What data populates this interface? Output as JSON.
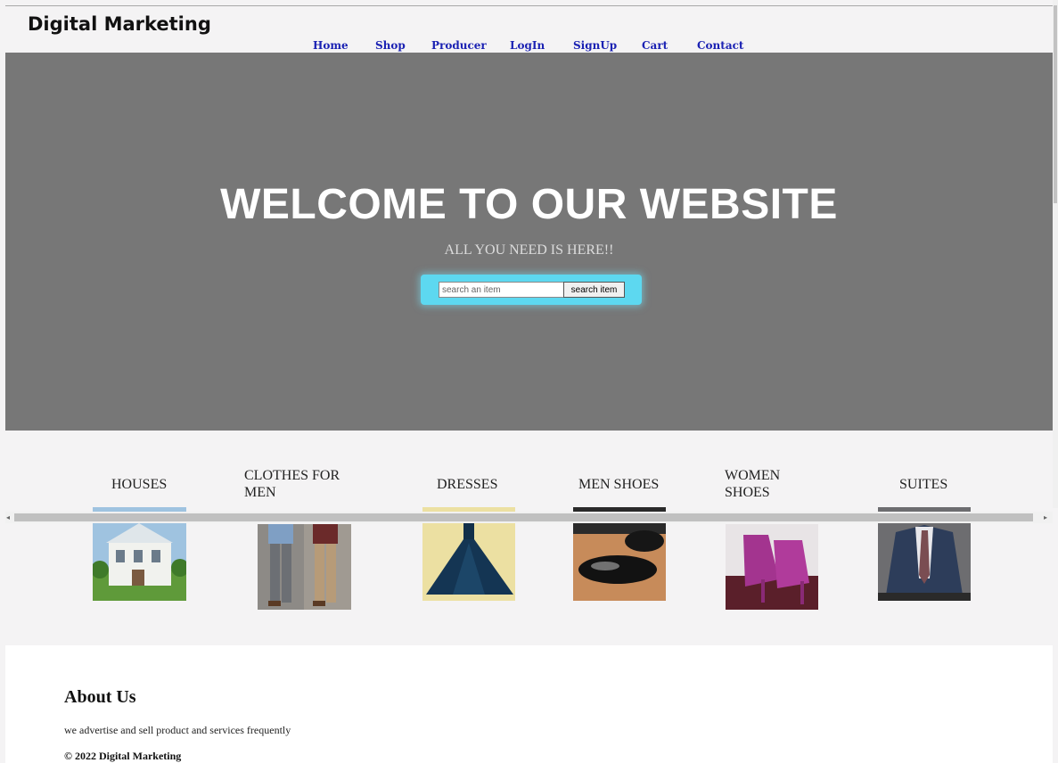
{
  "brand": "Digital Marketing",
  "nav": [
    "Home",
    "Shop",
    "Producer",
    "LogIn",
    "SignUp",
    "Cart",
    "Contact"
  ],
  "hero": {
    "title": "WELCOME TO OUR WEBSITE",
    "subtitle": "ALL YOU NEED IS HERE!!",
    "search_placeholder": "search an item",
    "search_button": "search item",
    "search_box_color": "#5dd8f0",
    "background": "#777777"
  },
  "categories": [
    {
      "label": "HOUSES",
      "icon": "house-image"
    },
    {
      "label": "CLOTHES FOR MEN",
      "icon": "men-clothes-image"
    },
    {
      "label": "DRESSES",
      "icon": "dress-image"
    },
    {
      "label": "MEN SHOES",
      "icon": "men-shoes-image"
    },
    {
      "label": "WOMEN SHOES",
      "icon": "women-shoes-image"
    },
    {
      "label": "SUITES",
      "icon": "suit-image"
    }
  ],
  "about": {
    "heading": "About Us",
    "text": "we advertise and sell product and services frequently",
    "copyright": "© 2022 Digital Marketing"
  },
  "colors": {
    "nav_link": "#1b22b3",
    "page_bg": "#f4f3f4"
  }
}
